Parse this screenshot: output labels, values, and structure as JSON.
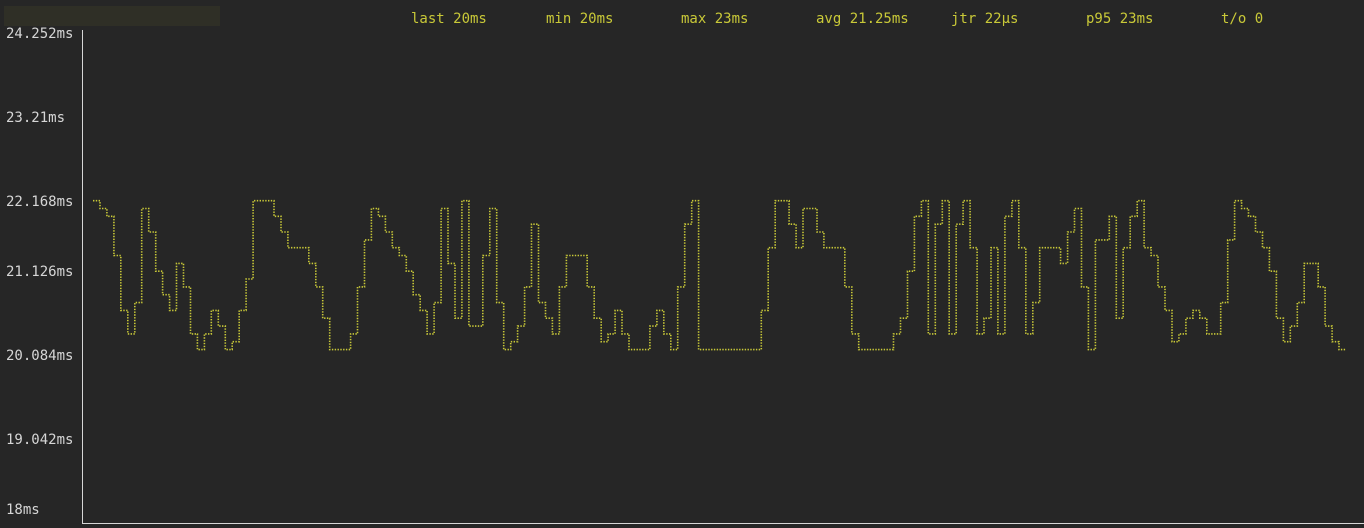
{
  "stats": {
    "last": "last 20ms",
    "min": "min 20ms",
    "max": "max 23ms",
    "avg": "avg 21.25ms",
    "jitter": "jtr 22µs",
    "p95": "p95 23ms",
    "timeouts": "t/o 0"
  },
  "colors": {
    "background": "#262626",
    "series": "#c9c938",
    "axis": "#d6d6d6"
  },
  "chart_data": {
    "type": "line",
    "title": "",
    "xlabel": "",
    "ylabel": "",
    "ylim": [
      18,
      24.252
    ],
    "y_ticks": [
      "24.252ms",
      "23.21ms",
      "22.168ms",
      "21.126ms",
      "20.084ms",
      "19.042ms",
      "18ms"
    ],
    "y_tick_values": [
      24.252,
      23.21,
      22.168,
      21.126,
      20.084,
      19.042,
      18
    ],
    "grid": false,
    "legend": "none",
    "series": [
      {
        "values": [
          22.1,
          22.0,
          21.9,
          21.4,
          20.7,
          20.4,
          20.8,
          22.0,
          21.7,
          21.2,
          20.9,
          20.7,
          21.3,
          21.0,
          20.4,
          20.2,
          20.4,
          20.7,
          20.5,
          20.2,
          20.3,
          20.7,
          21.1,
          22.1,
          22.1,
          22.1,
          21.9,
          21.7,
          21.5,
          21.5,
          21.5,
          21.3,
          21.0,
          20.6,
          20.2,
          20.2,
          20.2,
          20.4,
          21.0,
          21.6,
          22.0,
          21.9,
          21.7,
          21.5,
          21.4,
          21.2,
          20.9,
          20.7,
          20.4,
          20.8,
          22.0,
          21.3,
          20.6,
          22.1,
          20.5,
          20.5,
          21.4,
          22.0,
          20.8,
          20.2,
          20.3,
          20.5,
          21.0,
          21.8,
          20.8,
          20.6,
          20.4,
          21.0,
          21.4,
          21.4,
          21.4,
          21.0,
          20.6,
          20.3,
          20.4,
          20.7,
          20.4,
          20.2,
          20.2,
          20.2,
          20.5,
          20.7,
          20.4,
          20.2,
          21.0,
          21.8,
          22.1,
          20.2,
          20.2,
          20.2,
          20.2,
          20.2,
          20.2,
          20.2,
          20.2,
          20.2,
          20.7,
          21.5,
          22.1,
          22.1,
          21.8,
          21.5,
          22.0,
          22.0,
          21.7,
          21.5,
          21.5,
          21.5,
          21.0,
          20.4,
          20.2,
          20.2,
          20.2,
          20.2,
          20.2,
          20.4,
          20.6,
          21.2,
          21.9,
          22.1,
          20.4,
          21.8,
          22.1,
          20.4,
          21.8,
          22.1,
          21.5,
          20.4,
          20.6,
          21.5,
          20.4,
          21.9,
          22.1,
          21.5,
          20.4,
          20.8,
          21.5,
          21.5,
          21.5,
          21.3,
          21.7,
          22.0,
          21.0,
          20.2,
          21.6,
          21.6,
          21.9,
          20.6,
          21.5,
          21.9,
          22.1,
          21.5,
          21.4,
          21.0,
          20.7,
          20.3,
          20.4,
          20.6,
          20.7,
          20.6,
          20.4,
          20.4,
          20.8,
          21.6,
          22.1,
          22.0,
          21.9,
          21.7,
          21.5,
          21.2,
          20.6,
          20.3,
          20.5,
          20.8,
          21.3,
          21.3,
          21.0,
          20.5,
          20.3,
          20.2,
          20.2
        ]
      }
    ]
  }
}
